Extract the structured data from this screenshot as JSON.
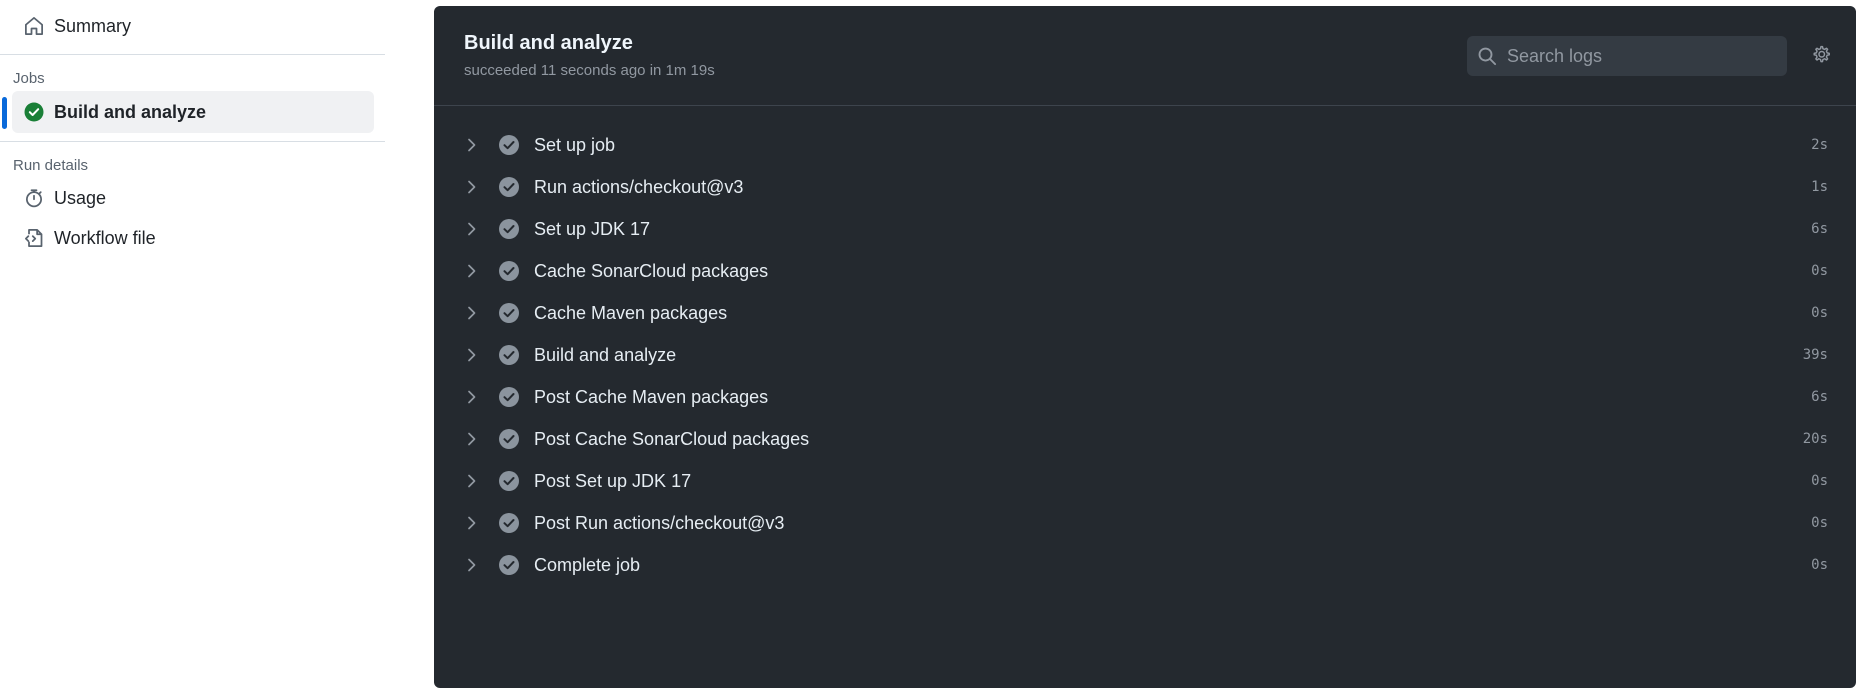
{
  "sidebar": {
    "summary_label": "Summary",
    "jobs_heading": "Jobs",
    "active_job_label": "Build and analyze",
    "run_details_heading": "Run details",
    "usage_label": "Usage",
    "workflow_file_label": "Workflow file",
    "accent_color": "#0969da",
    "success_color": "#1a7f37"
  },
  "job": {
    "title": "Build and analyze",
    "status": "succeeded 11 seconds ago in 1m 19s"
  },
  "search": {
    "placeholder": "Search logs"
  },
  "steps": [
    {
      "name": "Set up job",
      "duration": "2s"
    },
    {
      "name": "Run actions/checkout@v3",
      "duration": "1s"
    },
    {
      "name": "Set up JDK 17",
      "duration": "6s"
    },
    {
      "name": "Cache SonarCloud packages",
      "duration": "0s"
    },
    {
      "name": "Cache Maven packages",
      "duration": "0s"
    },
    {
      "name": "Build and analyze",
      "duration": "39s"
    },
    {
      "name": "Post Cache Maven packages",
      "duration": "6s"
    },
    {
      "name": "Post Cache SonarCloud packages",
      "duration": "20s"
    },
    {
      "name": "Post Set up JDK 17",
      "duration": "0s"
    },
    {
      "name": "Post Run actions/checkout@v3",
      "duration": "0s"
    },
    {
      "name": "Complete job",
      "duration": "0s"
    }
  ]
}
